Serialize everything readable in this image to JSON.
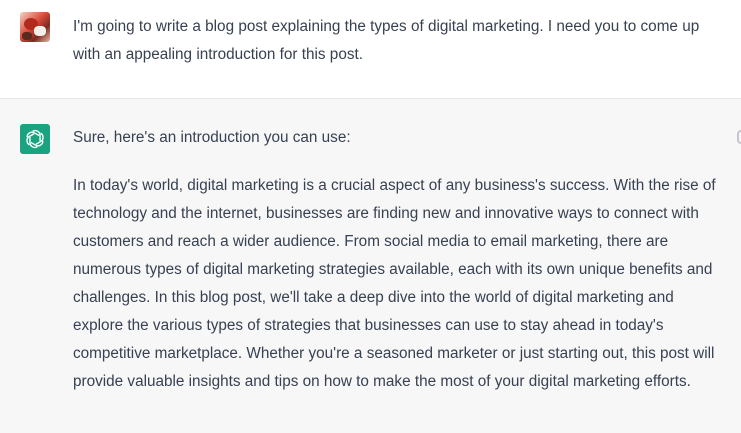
{
  "conversation": {
    "user_message": {
      "avatar": "user-avatar-photo",
      "text": "I'm going to write a blog post explaining the types of digital marketing. I need you to come up with an appealing introduction for this post."
    },
    "assistant_message": {
      "avatar": "openai-logo-icon",
      "lead": "Sure, here's an introduction you can use:",
      "body": "In today's world, digital marketing is a crucial aspect of any business's success. With the rise of technology and the internet, businesses are finding new and innovative ways to connect with customers and reach a wider audience. From social media to email marketing, there are numerous types of digital marketing strategies available, each with its own unique benefits and challenges. In this blog post, we'll take a deep dive into the world of digital marketing and explore the various types of strategies that businesses can use to stay ahead in today's competitive marketplace. Whether you're a seasoned marketer or just starting out, this post will provide valuable insights and tips on how to make the most of your digital marketing efforts."
    }
  },
  "colors": {
    "user_row_bg": "#ffffff",
    "assistant_row_bg": "#f7f7f8",
    "text": "#374151",
    "bot_avatar_bg": "#19a37f"
  }
}
